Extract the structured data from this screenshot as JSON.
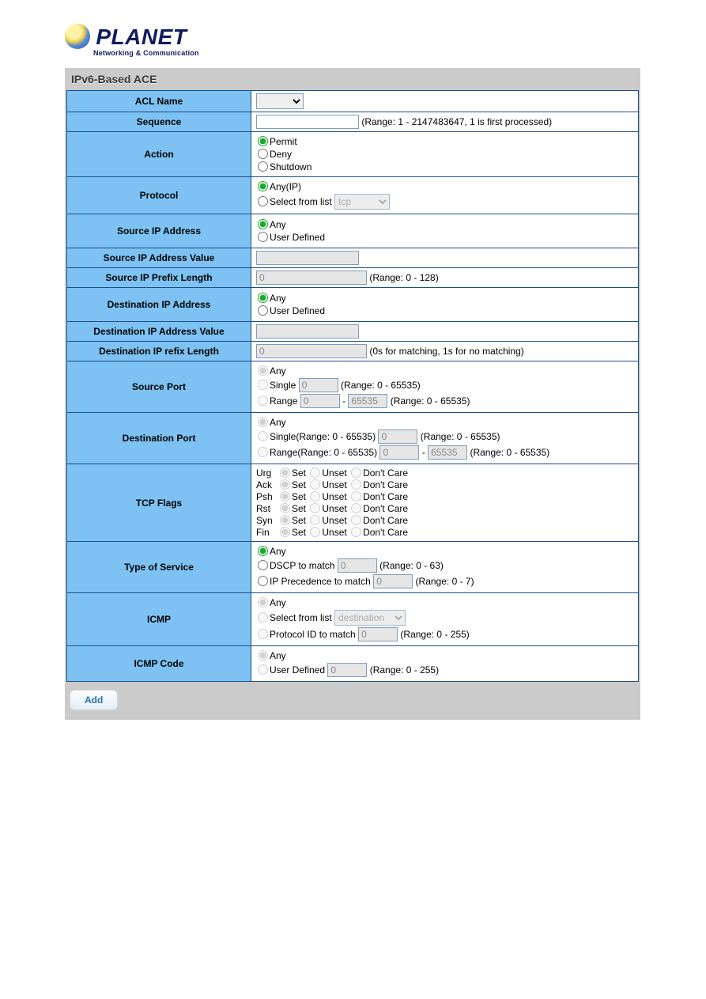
{
  "logo": {
    "brand": "PLANET",
    "tagline": "Networking & Communication"
  },
  "panel_title": "IPv6-Based ACE",
  "labels": {
    "acl_name": "ACL Name",
    "sequence": "Sequence",
    "action": "Action",
    "protocol": "Protocol",
    "src_ip": "Source IP Address",
    "src_ip_val": "Source IP Address Value",
    "src_ip_prefix": "Source IP Prefix Length",
    "dst_ip": "Destination IP Address",
    "dst_ip_val": "Destination IP Address Value",
    "dst_ip_prefix": "Destination IP refix Length",
    "src_port": "Source Port",
    "dst_port": "Destination Port",
    "tcp_flags": "TCP Flags",
    "tos": "Type of Service",
    "icmp": "ICMP",
    "icmp_code": "ICMP Code"
  },
  "hints": {
    "sequence": "(Range: 1 - 2147483647, 1 is first processed)",
    "prefix128": "(Range: 0 - 128)",
    "prefix_match": "(0s for matching, 1s for no matching)",
    "port": "(Range: 0 - 65535)",
    "dscp": "(Range: 0 - 63)",
    "ipprec": "(Range: 0 - 7)",
    "icmp255": "(Range: 0 - 255)"
  },
  "radio": {
    "permit": "Permit",
    "deny": "Deny",
    "shutdown": "Shutdown",
    "any_ip": "Any(IP)",
    "select_from_list": "Select from list",
    "any": "Any",
    "user_defined": "User Defined",
    "single": "Single",
    "range": "Range",
    "single_paren": "Single(Range: 0 - 65535)",
    "range_paren": "Range(Range: 0 - 65535)",
    "dscp_match": "DSCP to match",
    "ipprec_match": "IP Precedence to match",
    "proto_id_match": "Protocol ID to match",
    "set": "Set",
    "unset": "Unset",
    "dontcare": "Don't Care"
  },
  "tcpflags": [
    "Urg",
    "Ack",
    "Psh",
    "Rst",
    "Syn",
    "Fin"
  ],
  "placeholders": {
    "zero": "0",
    "port_hi": "65535",
    "tcp": "tcp",
    "destination": "destination"
  },
  "dash": "-",
  "add_button": "Add"
}
